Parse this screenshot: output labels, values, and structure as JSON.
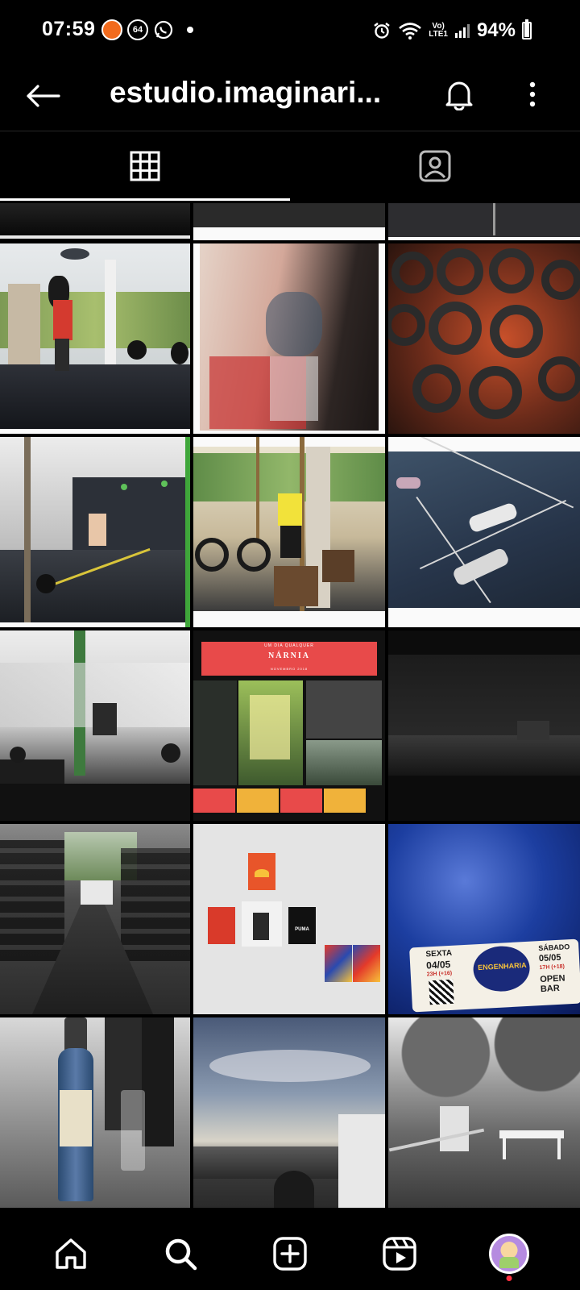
{
  "status_bar": {
    "time": "07:59",
    "badge": "64",
    "network_top": "Vo)",
    "network_bottom": "LTE1",
    "battery": "94%",
    "battery_level": 0.94
  },
  "header": {
    "title": "estudio.imaginari..."
  },
  "tabs": [
    {
      "name": "posts-grid",
      "icon": "grid-icon",
      "active": true
    },
    {
      "name": "tagged",
      "icon": "tagged-person-icon",
      "active": false
    }
  ],
  "posts": [
    {
      "label": "Dark gym floor (cropped)",
      "bg": "#1a1a1a"
    },
    {
      "label": "Gym floor grey (cropped)",
      "bg": "#2b2b2b"
    },
    {
      "label": "Gym court lines (cropped)",
      "bg": "#333333"
    },
    {
      "label": "Wall ball throw",
      "bg": "#6e7a6a"
    },
    {
      "label": "Dancer double exposure",
      "bg": "#b88478"
    },
    {
      "label": "Weight plates",
      "bg": "#7a2e1a"
    },
    {
      "label": "Gym interior barbell",
      "bg": "#5a5a5a"
    },
    {
      "label": "Rings athlete yellow shirt",
      "bg": "#8a8a6a"
    },
    {
      "label": "Athletes on floor",
      "bg": "#3a4a5a"
    },
    {
      "label": "Box jumps",
      "bg": "#6a6a6a"
    },
    {
      "label": "Narnia collage",
      "bg": "#2a2a2a",
      "poster_small": "UM DIA QUALQUER",
      "poster_title": "NÁRNIA",
      "poster_sub": "NOVEMBRO 2018"
    },
    {
      "label": "Dark gym silhouette",
      "bg": "#111111"
    },
    {
      "label": "Spin bikes",
      "bg": "#3e3e3e"
    },
    {
      "label": "Posters on wall",
      "bg": "#d8d8d8",
      "brand": "PUMA"
    },
    {
      "label": "Party flyer",
      "bg": "#1c3ea0",
      "day1": "SEXTA",
      "date1": "04/05",
      "info1": "23H (+16)",
      "event": "ENGENHARIA",
      "day2": "SÁBADO",
      "date2": "05/05",
      "info2": "17H (+18)",
      "extra": "OPEN BAR"
    },
    {
      "label": "Beer bottle",
      "bg": "#8a8a8a"
    },
    {
      "label": "Sunset sky",
      "bg": "#5a6a80"
    },
    {
      "label": "Park bench",
      "bg": "#777777"
    }
  ],
  "bottom_nav": [
    {
      "name": "home",
      "icon": "home-icon"
    },
    {
      "name": "search",
      "icon": "search-icon"
    },
    {
      "name": "create",
      "icon": "plus-square-icon"
    },
    {
      "name": "reels",
      "icon": "reels-icon"
    },
    {
      "name": "profile",
      "icon": "avatar"
    }
  ],
  "colors": {
    "background": "#000000",
    "text": "#ffffff",
    "notification": "#ff3040"
  }
}
